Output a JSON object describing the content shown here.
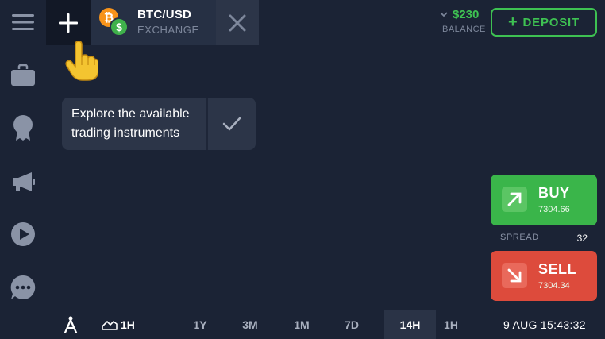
{
  "colors": {
    "background": "#1b2335",
    "accent_green": "#3ec152",
    "buy": "#3ab54a",
    "sell": "#dd4b3c",
    "btc": "#f7931a"
  },
  "sidebar": {
    "items": [
      {
        "icon": "menu-icon"
      },
      {
        "icon": "briefcase-icon"
      },
      {
        "icon": "award-ribbon-icon"
      },
      {
        "icon": "megaphone-icon"
      },
      {
        "icon": "play-icon"
      },
      {
        "icon": "chat-icon"
      }
    ]
  },
  "header": {
    "add_button_icon": "plus-icon",
    "asset": {
      "name": "BTC/USD",
      "type": "EXCHANGE",
      "coin_top": "₿",
      "coin_bottom": "$"
    },
    "close_icon": "close-icon",
    "balance": {
      "amount": "$230",
      "label": "BALANCE"
    },
    "deposit": {
      "plus": "+",
      "label": "DEPOSIT"
    }
  },
  "tooltip": {
    "text": "Explore the available trading instruments",
    "confirm_icon": "check-icon"
  },
  "trade": {
    "buy": {
      "label": "BUY",
      "price": "7304.66"
    },
    "spread": {
      "label": "SPREAD",
      "value": "32"
    },
    "sell": {
      "label": "SELL",
      "price": "7304.34"
    }
  },
  "bottom_bar": {
    "chart_type_label": "1H",
    "timeframes": [
      {
        "label": "1Y",
        "active": false
      },
      {
        "label": "3M",
        "active": false
      },
      {
        "label": "1M",
        "active": false
      },
      {
        "label": "7D",
        "active": false
      },
      {
        "label": "14H",
        "active": true
      },
      {
        "label": "1H",
        "active": false
      }
    ],
    "datetime": "9 AUG 15:43:32"
  }
}
